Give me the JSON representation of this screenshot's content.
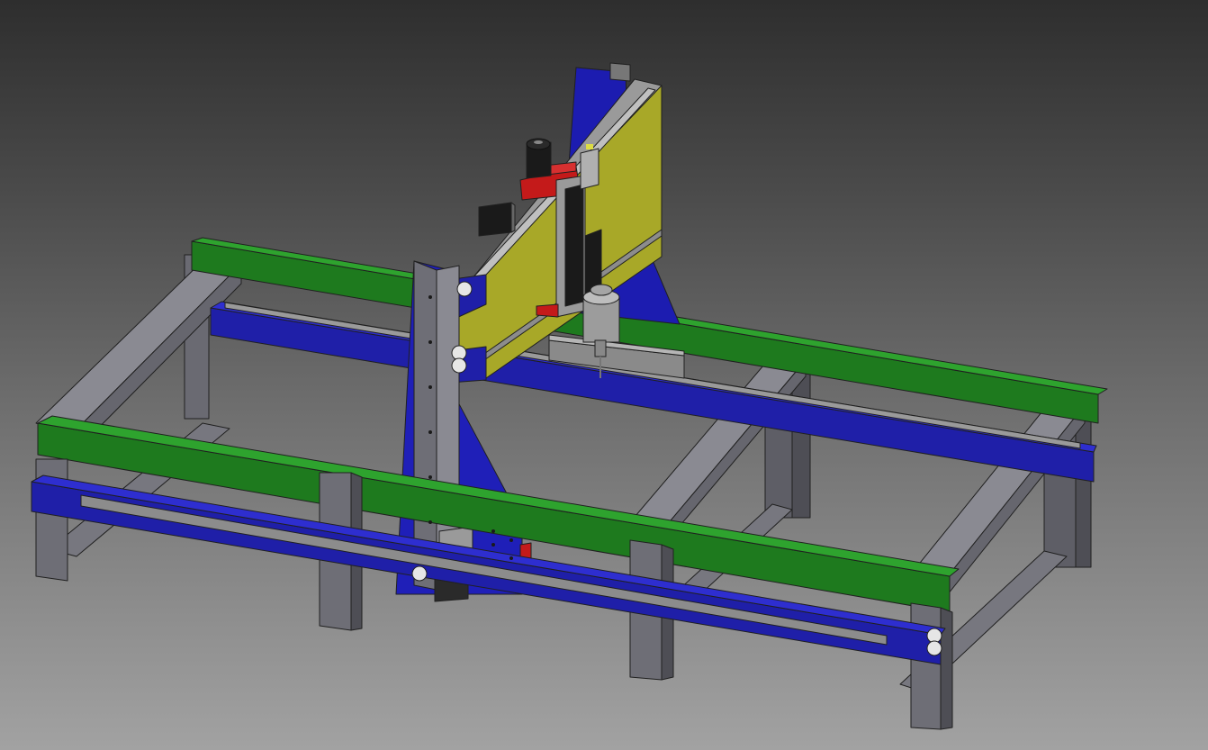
{
  "view": {
    "background": {
      "top": "#2e2e2e",
      "bottom": "#a2a2a2"
    }
  },
  "colors": {
    "frame_gray": "#6e6e76",
    "frame_gray_light": "#8a8a92",
    "frame_gray_dark": "#55555c",
    "rail_blue": "#1f1fa8",
    "rail_blue_light": "#2a2acc",
    "rail_green": "#1e7a1e",
    "rail_green_light": "#2a9a2a",
    "gantry_yellow": "#a8a82a",
    "carriage_red": "#c41a1a",
    "motor_black": "#1a1a1a",
    "bearing_white": "#e6e6e6",
    "linear_rail": "#8c8c8c"
  },
  "model": {
    "subject": "cnc-router-frame",
    "components": [
      "steel-frame",
      "green-table-rails",
      "blue-linear-rail-beams",
      "blue-gantry-side-plates",
      "yellow-gantry-beam",
      "red-z-carriage",
      "stepper-motors",
      "spindle",
      "guide-bearings"
    ]
  }
}
